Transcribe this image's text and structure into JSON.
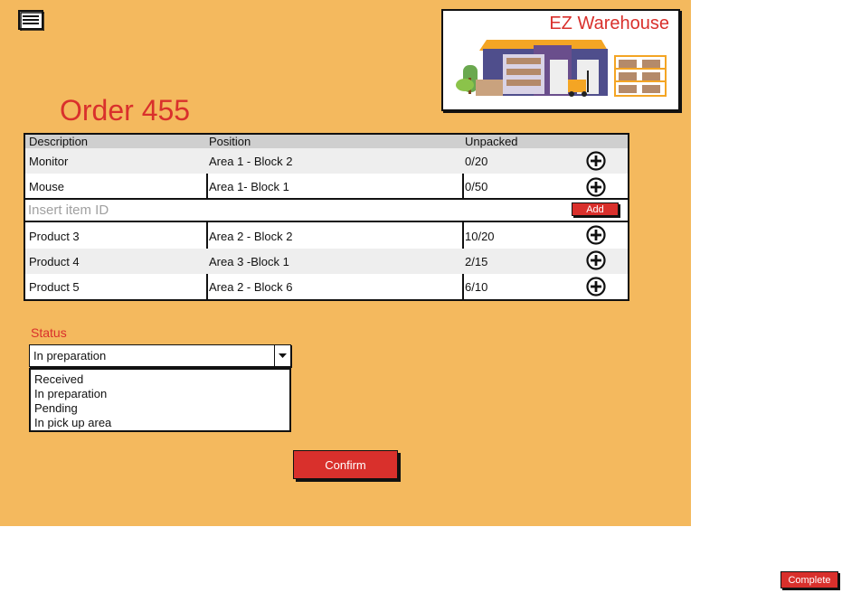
{
  "app": {
    "brand": "EZ Warehouse"
  },
  "order": {
    "title": "Order 455"
  },
  "table": {
    "headers": [
      "Description",
      "Position",
      "Unpacked"
    ],
    "rows_top": [
      {
        "description": "Monitor",
        "position": "Area 1 - Block 2",
        "unpacked": "0/20"
      },
      {
        "description": "Mouse",
        "position": "Area 1- Block 1",
        "unpacked": "0/50"
      }
    ],
    "insert": {
      "placeholder": "Insert item ID",
      "add_label": "Add"
    },
    "rows_bottom": [
      {
        "description": "Product 3",
        "position": "Area 2 - Block 2",
        "unpacked": "10/20"
      },
      {
        "description": "Product 4",
        "position": "Area 3 -Block 1",
        "unpacked": "2/15"
      },
      {
        "description": "Product 5",
        "position": "Area 2 - Block 6",
        "unpacked": "6/10"
      }
    ]
  },
  "status": {
    "label": "Status",
    "selected": "In preparation",
    "options": [
      "Received",
      "In preparation",
      "Pending",
      "In pick up area"
    ]
  },
  "buttons": {
    "confirm": "Confirm",
    "complete": "Complete"
  },
  "colors": {
    "panel": "#f4b95e",
    "accent": "#d9302c"
  },
  "icons": [
    "menu-icon",
    "plus-circle-icon",
    "dropdown-arrow-icon",
    "warehouse-logo-icon"
  ]
}
